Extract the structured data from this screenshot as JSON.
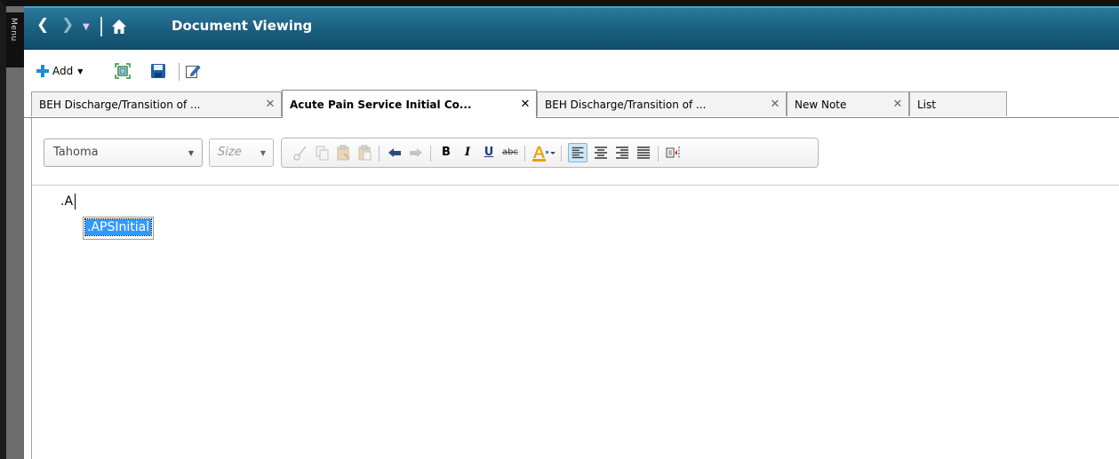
{
  "sidebar": {
    "menu_label": "Menu"
  },
  "window": {
    "title": "Document Viewing"
  },
  "toolbar": {
    "add_label": "Add"
  },
  "tabs": [
    {
      "label": "BEH Discharge/Transition of ...",
      "active": false
    },
    {
      "label": "Acute Pain Service Initial Co...",
      "active": true
    },
    {
      "label": "BEH Discharge/Transition of ...",
      "active": false
    },
    {
      "label": "New Note",
      "active": false
    },
    {
      "label": "List",
      "active": false
    }
  ],
  "formatting": {
    "font_family_value": "Tahoma",
    "font_size_placeholder": "Size",
    "bold_label": "B",
    "italic_label": "I",
    "underline_label": "U",
    "strike_label": "abc"
  },
  "editor": {
    "typed_text": ".A",
    "suggestion": ".APSInitial"
  },
  "colors": {
    "titlebar": "#1a5f80",
    "accent": "#1a8fd6",
    "selection": "#3399ff"
  }
}
